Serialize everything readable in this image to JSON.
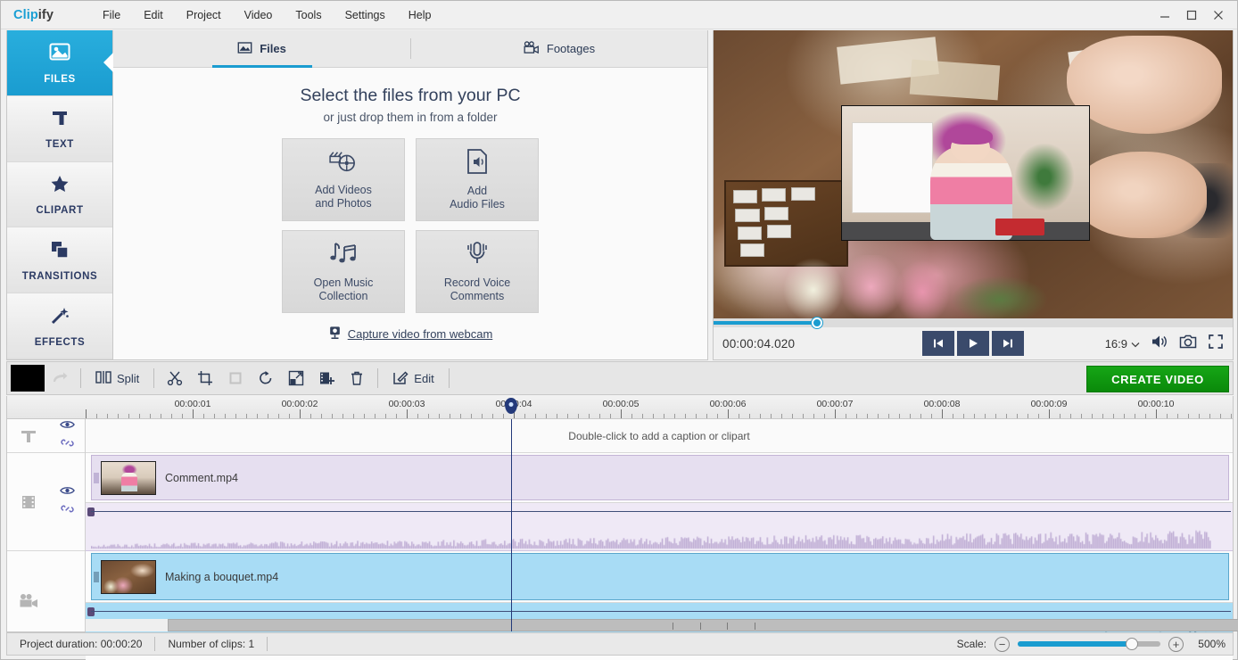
{
  "app": {
    "logo_primary": "Clip",
    "logo_secondary": "ify",
    "menu": [
      "File",
      "Edit",
      "Project",
      "Video",
      "Tools",
      "Settings",
      "Help"
    ],
    "window_buttons": [
      "minimize-button",
      "maximize-button",
      "close-button"
    ]
  },
  "sidebar": {
    "items": [
      {
        "label": "FILES",
        "icon": "image-icon",
        "active": true
      },
      {
        "label": "TEXT",
        "icon": "text-t-icon",
        "active": false
      },
      {
        "label": "CLIPART",
        "icon": "star-icon",
        "active": false
      },
      {
        "label": "TRANSITIONS",
        "icon": "layers-icon",
        "active": false
      },
      {
        "label": "EFFECTS",
        "icon": "magic-wand-icon",
        "active": false
      }
    ]
  },
  "panel": {
    "tabs": [
      {
        "label": "Files",
        "icon": "picture-icon",
        "active": true
      },
      {
        "label": "Footages",
        "icon": "footage-camera-icon",
        "active": false
      }
    ],
    "headline": "Select the files from your PC",
    "subhead": "or just drop them in from a folder",
    "cards": [
      {
        "line1": "Add Videos",
        "line2": "and Photos",
        "icon": "clapperboard-reel-icon"
      },
      {
        "line1": "Add",
        "line2": "Audio Files",
        "icon": "audio-file-icon"
      },
      {
        "line1": "Open Music",
        "line2": "Collection",
        "icon": "music-notes-icon"
      },
      {
        "line1": "Record Voice",
        "line2": "Comments",
        "icon": "microphone-icon"
      }
    ],
    "webcam_link": "Capture video from webcam",
    "webcam_icon": "webcam-icon"
  },
  "preview": {
    "timecode": "00:00:04.020",
    "seek_percent": 20,
    "buttons": [
      {
        "name": "previous-frame-button",
        "icon": "skip-back-icon"
      },
      {
        "name": "play-button",
        "icon": "play-icon"
      },
      {
        "name": "next-frame-button",
        "icon": "skip-forward-icon"
      }
    ],
    "aspect_ratio": "16:9",
    "right_icons": [
      "volume-icon",
      "snapshot-camera-icon",
      "fullscreen-icon"
    ]
  },
  "toolbar": {
    "undo_icon": "undo-icon",
    "redo_icon": "redo-icon",
    "split_label": "Split",
    "split_icon": "split-icon",
    "edit_label": "Edit",
    "edit_icon": "edit-pencil-icon",
    "icons": [
      "scissors-icon",
      "crop-icon",
      "stop-square-icon",
      "rotate-icon",
      "pip-icon",
      "add-clip-icon",
      "trash-icon"
    ],
    "create_video_label": "CREATE VIDEO"
  },
  "timeline": {
    "ruler_labels": [
      "00:00:01",
      "00:00:02",
      "00:00:03",
      "00:00:04",
      "00:00:05",
      "00:00:06",
      "00:00:07",
      "00:00:08",
      "00:00:09",
      "00:00:10"
    ],
    "playhead_time": "00:00:04",
    "text_track_hint": "Double-click to add a caption or clipart",
    "tracks": [
      {
        "icon": "text-track-icon",
        "eye": "eye-icon",
        "link": "link-icon"
      },
      {
        "icon": "filmstrip-track-icon",
        "eye": "eye-icon",
        "link": "link-icon"
      },
      {
        "icon": "movie-camera-track-icon"
      }
    ],
    "clips": [
      {
        "name": "Comment.mp4",
        "track": "overlay",
        "color": "#e6dff0"
      },
      {
        "name": "Making a bouquet.mp4",
        "track": "main",
        "color": "#a8dcf5"
      }
    ]
  },
  "status": {
    "project_duration_label": "Project duration:",
    "project_duration_value": "00:00:20",
    "clips_label": "Number of clips: 1",
    "scale_label": "Scale:",
    "scale_value": "500%",
    "scale_percent": 80,
    "zoom_out_icon": "minus-circle-icon",
    "zoom_in_icon": "plus-circle-icon"
  },
  "colors": {
    "accent": "#1a9cd0",
    "navy": "#2b3a55",
    "create_green": "#0f9b0f",
    "clip_purple": "#e6dff0",
    "clip_blue": "#a8dcf5"
  }
}
